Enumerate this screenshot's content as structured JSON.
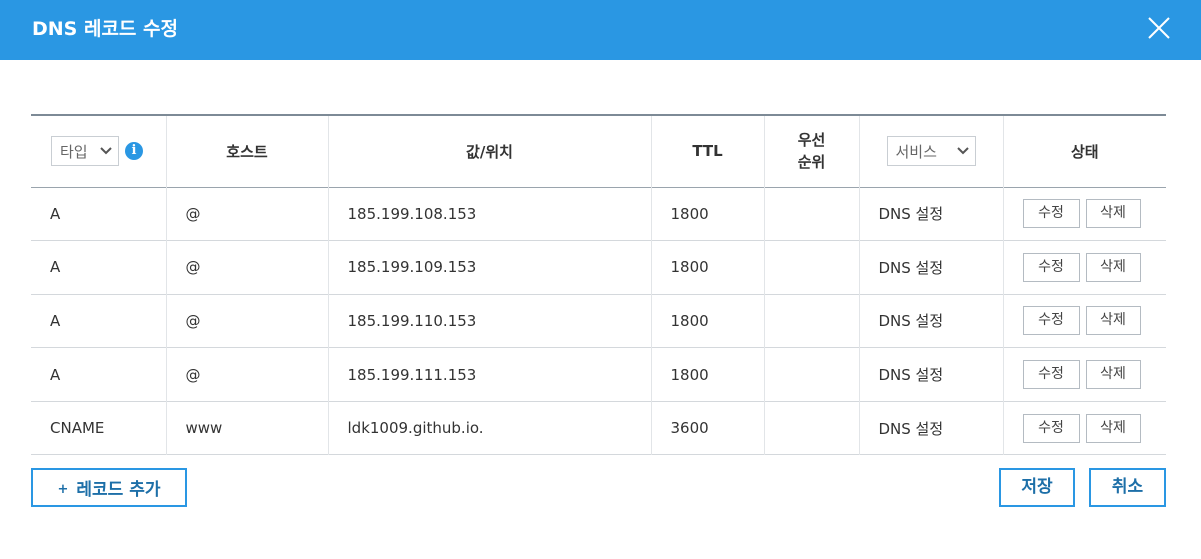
{
  "dialog": {
    "title": "DNS 레코드 수정",
    "header_color": "#2a97e3"
  },
  "table": {
    "headers": {
      "type_select": "타입",
      "host": "호스트",
      "value": "값/위치",
      "ttl": "TTL",
      "priority_line1": "우선",
      "priority_line2": "순위",
      "service_select": "서비스",
      "status": "상태"
    },
    "rows": [
      {
        "type": "A",
        "host": "@",
        "value": "185.199.108.153",
        "ttl": "1800",
        "priority": "",
        "service": "DNS 설정",
        "edit": "수정",
        "delete": "삭제"
      },
      {
        "type": "A",
        "host": "@",
        "value": "185.199.109.153",
        "ttl": "1800",
        "priority": "",
        "service": "DNS 설정",
        "edit": "수정",
        "delete": "삭제"
      },
      {
        "type": "A",
        "host": "@",
        "value": "185.199.110.153",
        "ttl": "1800",
        "priority": "",
        "service": "DNS 설정",
        "edit": "수정",
        "delete": "삭제"
      },
      {
        "type": "A",
        "host": "@",
        "value": "185.199.111.153",
        "ttl": "1800",
        "priority": "",
        "service": "DNS 설정",
        "edit": "수정",
        "delete": "삭제"
      },
      {
        "type": "CNAME",
        "host": "www",
        "value": "ldk1009.github.io.",
        "ttl": "3600",
        "priority": "",
        "service": "DNS 설정",
        "edit": "수정",
        "delete": "삭제"
      }
    ]
  },
  "footer": {
    "add_plus": "+",
    "add_label": "레코드 추가",
    "save_label": "저장",
    "cancel_label": "취소"
  },
  "icons": {
    "close": "close-icon",
    "info": "info-icon",
    "chevron": "chevron-down-icon"
  }
}
